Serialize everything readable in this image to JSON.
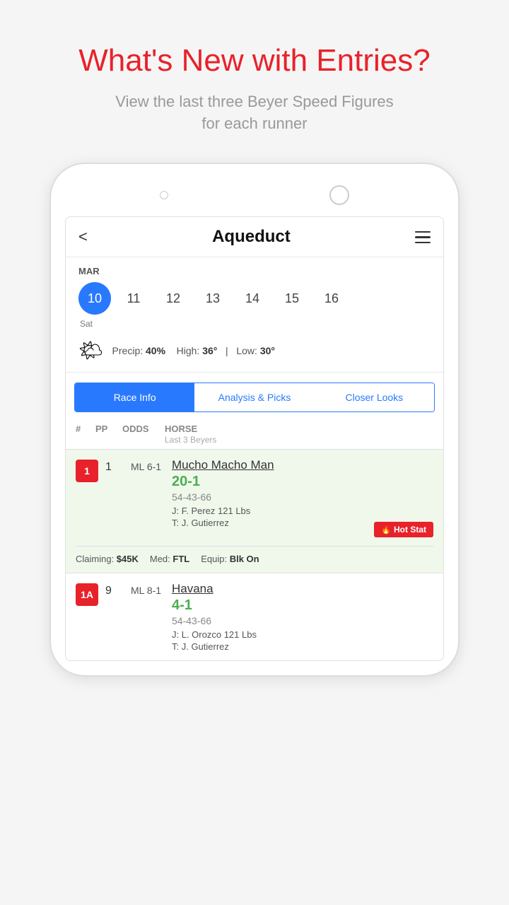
{
  "page": {
    "title": "What's New with Entries?",
    "subtitle": "View the last three Beyer Speed Figures\nfor each runner"
  },
  "app": {
    "header_title": "Aqueduct",
    "back_label": "<",
    "hamburger_label": "menu"
  },
  "calendar": {
    "month": "MAR",
    "dates": [
      "10",
      "11",
      "12",
      "13",
      "14",
      "15",
      "16"
    ],
    "selected_date": "10",
    "selected_day": "Sat"
  },
  "weather": {
    "precip_label": "Precip:",
    "precip_value": "40%",
    "high_label": "High:",
    "high_value": "36°",
    "low_label": "Low:",
    "low_value": "30°",
    "separator": "|"
  },
  "tabs": [
    {
      "label": "Race Info",
      "active": true
    },
    {
      "label": "Analysis & Picks",
      "active": false
    },
    {
      "label": "Closer Looks",
      "active": false
    }
  ],
  "table_header": {
    "col1": "#",
    "col2": "PP",
    "col3": "ODDS",
    "col4": "HORSE",
    "col4_sub": "Last 3 Beyers"
  },
  "runners": [
    {
      "badge": "1",
      "pp": "1",
      "odds": "ML 6-1",
      "name": "Mucho Macho Man",
      "ml_odds": "20-1",
      "beyers": "54-43-66",
      "jockey": "J: F. Perez  121 Lbs",
      "trainer": "T: J. Gutierrez",
      "hot_stat": "Hot Stat",
      "claiming": "Claiming: $45K",
      "med": "Med: FTL",
      "equip": "Equip: Blk On",
      "bg": "green"
    },
    {
      "badge": "1A",
      "pp": "9",
      "odds": "ML 8-1",
      "name": "Havana",
      "ml_odds": "4-1",
      "beyers": "54-43-66",
      "jockey": "J: L. Orozco  121 Lbs",
      "trainer": "T: J. Gutierrez",
      "hot_stat": "",
      "claiming": "",
      "med": "",
      "equip": "",
      "bg": "white"
    }
  ]
}
